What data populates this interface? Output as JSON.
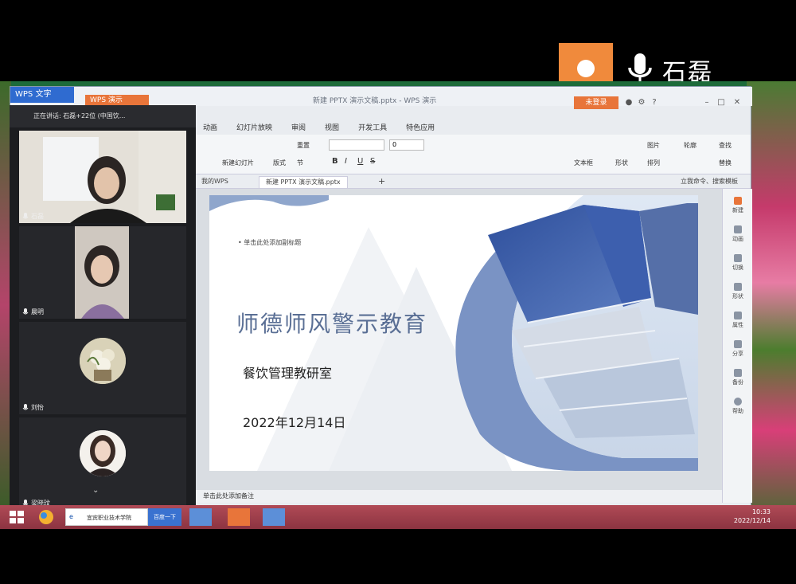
{
  "speaker": {
    "name": "石磊"
  },
  "wps": {
    "brand": "WPS 文字",
    "tab_other": "WPS 演示",
    "title": "新建 PPTX 演示文稿.pptx - WPS 演示",
    "login": "未登录",
    "ribbon_tabs": [
      "动画",
      "幻灯片放映",
      "审阅",
      "视图",
      "开发工具",
      "特色应用"
    ],
    "ribbon_buttons": {
      "new_slide": "新建幻灯片",
      "layout": "版式",
      "section": "节",
      "reset": "重置",
      "font_size": "0",
      "bold": "B",
      "italic": "I",
      "underline": "U",
      "strike": "S",
      "textbox": "文本框",
      "shapes": "形状",
      "picture": "图片",
      "arrange": "排列",
      "outline": "轮廓",
      "find": "查找",
      "replace": "替换"
    },
    "doc_tabs": {
      "home": "我的WPS",
      "active": "新建 PPTX 演示文稿.pptx",
      "search": "立我命令、搜索模板"
    },
    "notes_placeholder": "单击此处添加备注",
    "right_panel": [
      "新建",
      "动画",
      "切换",
      "形状",
      "属性",
      "分享",
      "备份",
      "帮助"
    ]
  },
  "slide": {
    "subtitle_placeholder": "单击此处添加副标题",
    "title": "师德师风警示教育",
    "department": "餐饮管理教研室",
    "date": "2022年12月14日"
  },
  "meeting": {
    "bar_title": "正在讲话: 石磊+22位 (中国饮...",
    "participants": [
      {
        "name": "石磊"
      },
      {
        "name": "晨明"
      },
      {
        "name": "刘怡"
      },
      {
        "name": "梁晓玟"
      }
    ]
  },
  "taskbar": {
    "search_label": "百度一下",
    "search_text": "宜宾职业技术学院",
    "time": "10:33",
    "date": "2022/12/14"
  },
  "colors": {
    "accent": "#f08a3c",
    "slide_title": "#5a6f95",
    "taskbar": "#9c3c49"
  }
}
